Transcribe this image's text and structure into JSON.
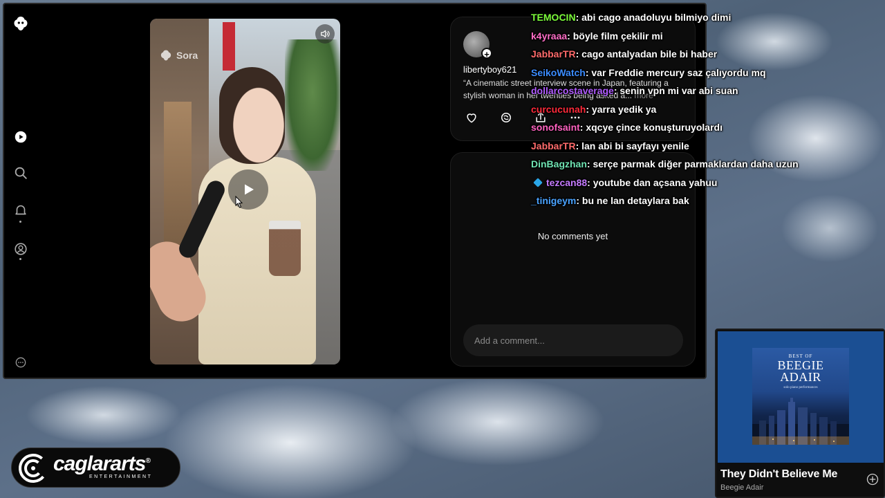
{
  "app": {
    "caption_more": "more",
    "username": "libertyboy621",
    "caption": "“A cinematic street interview scene in Japan, featuring a stylish woman in her twenties being asked a...",
    "no_comments": "No comments yet",
    "comment_placeholder": "Add a comment...",
    "video_watermark": "Sora",
    "nav_icons": [
      "sora-logo-icon",
      "video-icon",
      "search-icon",
      "bell-icon",
      "profile-icon",
      "more-icon"
    ],
    "action_icons": [
      "heart-icon",
      "remix-icon",
      "share-icon",
      "more-horizontal-icon"
    ]
  },
  "chat": [
    {
      "user": "TEMOCIN",
      "color": "#7CFC3A",
      "message": ": abi cago anadoluyu bilmiyo dimi"
    },
    {
      "user": "k4yraaa",
      "color": "#ff6ec7",
      "message": ": böyle film çekilir mi"
    },
    {
      "user": "JabbarTR",
      "color": "#ff6b6b",
      "message": ": cago antalyadan bile bi haber"
    },
    {
      "user": "SeikoWatch",
      "color": "#3b8cff",
      "message": ": var Freddie mercury saz çalıyordu mq"
    },
    {
      "user": "dollarcostaverage",
      "color": "#b05cff",
      "message": ": senin vpn mi var abi suan"
    },
    {
      "user": "curcucunah",
      "color": "#ff2a3a",
      "message": ": yarra yedik ya"
    },
    {
      "user": "sonofsaint",
      "color": "#ff62c0",
      "message": ": xqcye çince konuşturuyolardı"
    },
    {
      "user": "JabbarTR",
      "color": "#ff6b6b",
      "message": ": lan abi bi sayfayı yenile"
    },
    {
      "user": "DinBagzhan",
      "color": "#6fe3b2",
      "message": ": serçe parmak diğer parmaklardan daha uzun"
    },
    {
      "user": "tezcan88",
      "color": "#c57bff",
      "message": ": youtube dan açsana yahuu",
      "badge": true
    },
    {
      "user": "_tinigeym",
      "color": "#4aa3ff",
      "message": ": bu ne lan detaylara bak"
    }
  ],
  "music": {
    "cover_top": "BEST OF",
    "cover_name_1": "BEEGIE",
    "cover_name_2": "ADAIR",
    "cover_sub": "solo piano performances",
    "title": "They Didn't Believe Me",
    "artist": "Beegie Adair"
  },
  "brand": {
    "name": "caglararts",
    "reg": "®",
    "sub": "ENTERTAINMENT"
  }
}
